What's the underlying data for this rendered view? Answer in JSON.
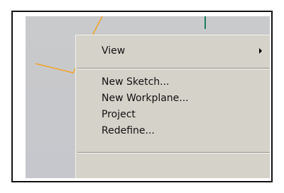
{
  "context_menu": {
    "items": [
      {
        "label": "View",
        "has_submenu": true
      },
      {
        "label": "New Sketch..."
      },
      {
        "label": "New Workplane..."
      },
      {
        "label": "Project"
      },
      {
        "label": "Redefine..."
      }
    ]
  },
  "icons": {
    "submenu": "chevron-right-icon"
  },
  "colors": {
    "viewport_bg": "#c9cacb",
    "menu_bg": "#d5d2ca",
    "wireframe_orange": "#f1a326",
    "wireframe_green": "#1c7f62"
  }
}
